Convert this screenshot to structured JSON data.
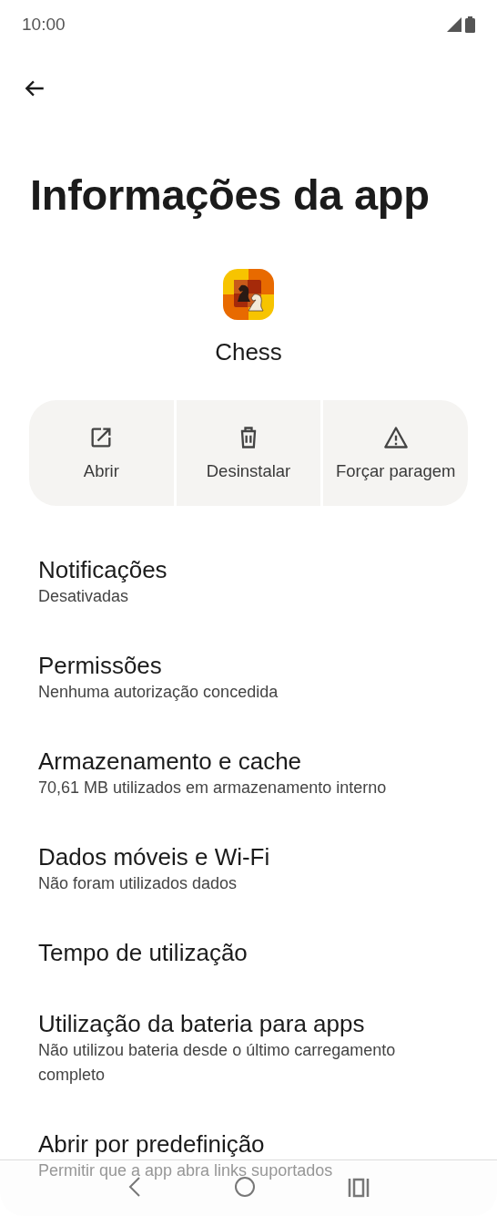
{
  "status_bar": {
    "time": "10:00"
  },
  "title": "Informações da app",
  "app": {
    "name": "Chess"
  },
  "actions": [
    {
      "kind": "open",
      "label": "Abrir"
    },
    {
      "kind": "uninstall",
      "label": "Desinstalar"
    },
    {
      "kind": "force_stop",
      "label": "Forçar paragem"
    }
  ],
  "settings": [
    {
      "title": "Notificações",
      "subtitle": "Desativadas"
    },
    {
      "title": "Permissões",
      "subtitle": "Nenhuma autorização concedida"
    },
    {
      "title": "Armazenamento e cache",
      "subtitle": "70,61 MB utilizados em armazenamento interno"
    },
    {
      "title": "Dados móveis e Wi-Fi",
      "subtitle": "Não foram utilizados dados"
    },
    {
      "title": "Tempo de utilização"
    },
    {
      "title": "Utilização da bateria para apps",
      "subtitle": "Não utilizou bateria desde o último carregamento completo"
    },
    {
      "title": "Abrir por predefinição",
      "subtitle": "Permitir que a app abra links suportados"
    }
  ]
}
